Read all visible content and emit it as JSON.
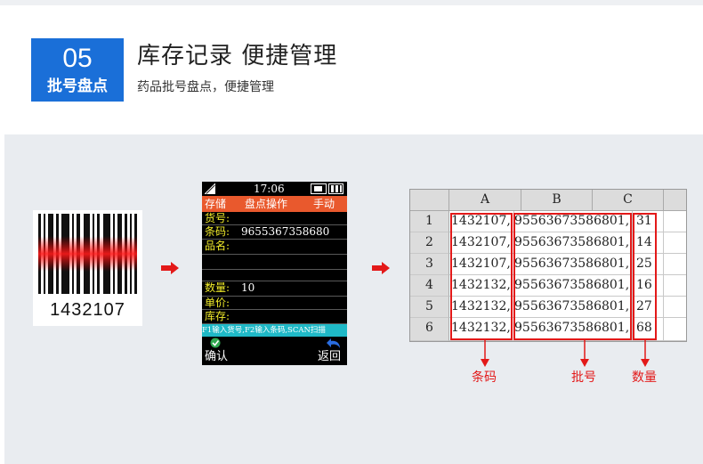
{
  "header": {
    "badge_number": "05",
    "badge_label": "批号盘点",
    "title": "库存记录  便捷管理",
    "subtitle": "药品批号盘点，便捷管理"
  },
  "barcode": {
    "text": "1432107"
  },
  "device": {
    "time": "17:06",
    "menu": [
      "存储",
      "盘点操作",
      "手动"
    ],
    "fields": [
      {
        "label": "货号:",
        "value": ""
      },
      {
        "label": "条码:",
        "value": "9655367358680"
      },
      {
        "label": "品名:",
        "value": ""
      },
      {
        "label": "",
        "value": ""
      },
      {
        "label": "",
        "value": ""
      },
      {
        "label": "数量:",
        "value": "10"
      },
      {
        "label": "单价:",
        "value": ""
      },
      {
        "label": "库存:",
        "value": ""
      }
    ],
    "hint": "F1输入货号,F2输入条码,SCAN扫描",
    "confirm_label": "确认",
    "back_label": "返回"
  },
  "spreadsheet": {
    "columns": [
      "A",
      "B",
      "C"
    ],
    "rows": [
      {
        "num": "1",
        "a": "1432107,",
        "b": "95563673586801,",
        "c": "31"
      },
      {
        "num": "2",
        "a": "1432107,",
        "b": "95563673586801,",
        "c": "14"
      },
      {
        "num": "3",
        "a": "1432107,",
        "b": "95563673586801,",
        "c": "25"
      },
      {
        "num": "4",
        "a": "1432132,",
        "b": "95563673586801,",
        "c": "16"
      },
      {
        "num": "5",
        "a": "1432132,",
        "b": "95563673586801,",
        "c": "27"
      },
      {
        "num": "6",
        "a": "1432132,",
        "b": "95563673586801,",
        "c": "68"
      }
    ]
  },
  "annotations": {
    "barcode": "条码",
    "batch": "批号",
    "quantity": "数量"
  },
  "colors": {
    "accent_blue": "#1a6fd8",
    "alert_red": "#e31919",
    "menu_orange": "#e9592d",
    "hint_cyan": "#1fb9c7",
    "label_yellow": "#f3ee2b"
  }
}
